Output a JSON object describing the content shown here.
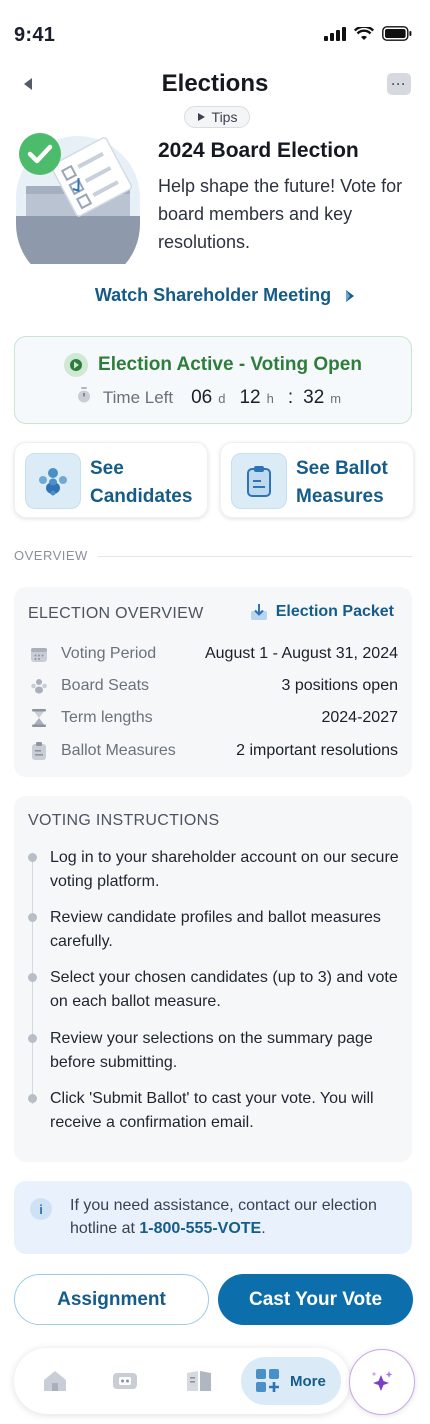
{
  "status_bar": {
    "time": "9:41"
  },
  "header": {
    "title": "Elections",
    "more_label": "···",
    "tips_label": "Tips"
  },
  "hero": {
    "title": "2024 Board Election",
    "description": "Help shape the future! Vote for board members and key resolutions.",
    "watch_link": "Watch Shareholder Meeting"
  },
  "status_card": {
    "label": "Election Active - Voting Open",
    "time_left_label": "Time Left",
    "days": "06",
    "days_unit": "d",
    "hours": "12",
    "hours_unit": "h",
    "minutes": "32",
    "minutes_unit": "m"
  },
  "actions": [
    {
      "line1": "See",
      "line2": "Candidates",
      "icon": "people-icon"
    },
    {
      "line1": "See Ballot",
      "line2": "Measures",
      "icon": "clipboard-icon"
    }
  ],
  "section_label": "OVERVIEW",
  "overview": {
    "heading": "ELECTION OVERVIEW",
    "packet_label": "Election Packet",
    "rows": [
      {
        "icon": "calendar-icon",
        "label": "Voting Period",
        "value": "August 1 - August 31, 2024"
      },
      {
        "icon": "people-icon",
        "label": "Board Seats",
        "value": "3 positions open"
      },
      {
        "icon": "hourglass-icon",
        "label": "Term lengths",
        "value": "2024-2027"
      },
      {
        "icon": "clipboard-icon",
        "label": "Ballot Measures",
        "value": "2 important resolutions"
      }
    ]
  },
  "instructions": {
    "heading": "VOTING INSTRUCTIONS",
    "steps": [
      "Log in to your shareholder account on our secure voting platform.",
      "Review candidate profiles and ballot measures carefully.",
      "Select your chosen candidates (up to 3) and vote on each ballot measure.",
      "Review your selections on the summary page before submitting.",
      "Click 'Submit Ballot' to cast your vote. You will receive a confirmation email."
    ]
  },
  "help": {
    "text_before": "If you need assistance, contact our election hotline at ",
    "phone": "1-800-555-VOTE",
    "text_after": "."
  },
  "buttons": {
    "secondary": "Assignment",
    "primary": "Cast Your Vote"
  },
  "bottom_nav": {
    "more_label": "More"
  },
  "colors": {
    "accent": "#0c6fab",
    "link": "#155c8a",
    "success": "#2f7d3c"
  }
}
